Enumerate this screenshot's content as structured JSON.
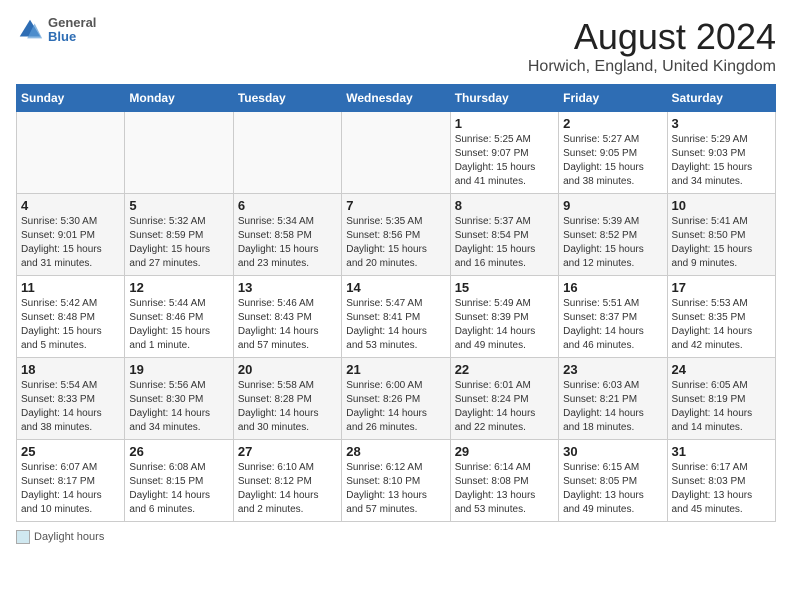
{
  "header": {
    "title": "August 2024",
    "subtitle": "Horwich, England, United Kingdom",
    "logo_general": "General",
    "logo_blue": "Blue"
  },
  "days_of_week": [
    "Sunday",
    "Monday",
    "Tuesday",
    "Wednesday",
    "Thursday",
    "Friday",
    "Saturday"
  ],
  "weeks": [
    [
      {
        "day": "",
        "info": ""
      },
      {
        "day": "",
        "info": ""
      },
      {
        "day": "",
        "info": ""
      },
      {
        "day": "",
        "info": ""
      },
      {
        "day": "1",
        "info": "Sunrise: 5:25 AM\nSunset: 9:07 PM\nDaylight: 15 hours and 41 minutes."
      },
      {
        "day": "2",
        "info": "Sunrise: 5:27 AM\nSunset: 9:05 PM\nDaylight: 15 hours and 38 minutes."
      },
      {
        "day": "3",
        "info": "Sunrise: 5:29 AM\nSunset: 9:03 PM\nDaylight: 15 hours and 34 minutes."
      }
    ],
    [
      {
        "day": "4",
        "info": "Sunrise: 5:30 AM\nSunset: 9:01 PM\nDaylight: 15 hours and 31 minutes."
      },
      {
        "day": "5",
        "info": "Sunrise: 5:32 AM\nSunset: 8:59 PM\nDaylight: 15 hours and 27 minutes."
      },
      {
        "day": "6",
        "info": "Sunrise: 5:34 AM\nSunset: 8:58 PM\nDaylight: 15 hours and 23 minutes."
      },
      {
        "day": "7",
        "info": "Sunrise: 5:35 AM\nSunset: 8:56 PM\nDaylight: 15 hours and 20 minutes."
      },
      {
        "day": "8",
        "info": "Sunrise: 5:37 AM\nSunset: 8:54 PM\nDaylight: 15 hours and 16 minutes."
      },
      {
        "day": "9",
        "info": "Sunrise: 5:39 AM\nSunset: 8:52 PM\nDaylight: 15 hours and 12 minutes."
      },
      {
        "day": "10",
        "info": "Sunrise: 5:41 AM\nSunset: 8:50 PM\nDaylight: 15 hours and 9 minutes."
      }
    ],
    [
      {
        "day": "11",
        "info": "Sunrise: 5:42 AM\nSunset: 8:48 PM\nDaylight: 15 hours and 5 minutes."
      },
      {
        "day": "12",
        "info": "Sunrise: 5:44 AM\nSunset: 8:46 PM\nDaylight: 15 hours and 1 minute."
      },
      {
        "day": "13",
        "info": "Sunrise: 5:46 AM\nSunset: 8:43 PM\nDaylight: 14 hours and 57 minutes."
      },
      {
        "day": "14",
        "info": "Sunrise: 5:47 AM\nSunset: 8:41 PM\nDaylight: 14 hours and 53 minutes."
      },
      {
        "day": "15",
        "info": "Sunrise: 5:49 AM\nSunset: 8:39 PM\nDaylight: 14 hours and 49 minutes."
      },
      {
        "day": "16",
        "info": "Sunrise: 5:51 AM\nSunset: 8:37 PM\nDaylight: 14 hours and 46 minutes."
      },
      {
        "day": "17",
        "info": "Sunrise: 5:53 AM\nSunset: 8:35 PM\nDaylight: 14 hours and 42 minutes."
      }
    ],
    [
      {
        "day": "18",
        "info": "Sunrise: 5:54 AM\nSunset: 8:33 PM\nDaylight: 14 hours and 38 minutes."
      },
      {
        "day": "19",
        "info": "Sunrise: 5:56 AM\nSunset: 8:30 PM\nDaylight: 14 hours and 34 minutes."
      },
      {
        "day": "20",
        "info": "Sunrise: 5:58 AM\nSunset: 8:28 PM\nDaylight: 14 hours and 30 minutes."
      },
      {
        "day": "21",
        "info": "Sunrise: 6:00 AM\nSunset: 8:26 PM\nDaylight: 14 hours and 26 minutes."
      },
      {
        "day": "22",
        "info": "Sunrise: 6:01 AM\nSunset: 8:24 PM\nDaylight: 14 hours and 22 minutes."
      },
      {
        "day": "23",
        "info": "Sunrise: 6:03 AM\nSunset: 8:21 PM\nDaylight: 14 hours and 18 minutes."
      },
      {
        "day": "24",
        "info": "Sunrise: 6:05 AM\nSunset: 8:19 PM\nDaylight: 14 hours and 14 minutes."
      }
    ],
    [
      {
        "day": "25",
        "info": "Sunrise: 6:07 AM\nSunset: 8:17 PM\nDaylight: 14 hours and 10 minutes."
      },
      {
        "day": "26",
        "info": "Sunrise: 6:08 AM\nSunset: 8:15 PM\nDaylight: 14 hours and 6 minutes."
      },
      {
        "day": "27",
        "info": "Sunrise: 6:10 AM\nSunset: 8:12 PM\nDaylight: 14 hours and 2 minutes."
      },
      {
        "day": "28",
        "info": "Sunrise: 6:12 AM\nSunset: 8:10 PM\nDaylight: 13 hours and 57 minutes."
      },
      {
        "day": "29",
        "info": "Sunrise: 6:14 AM\nSunset: 8:08 PM\nDaylight: 13 hours and 53 minutes."
      },
      {
        "day": "30",
        "info": "Sunrise: 6:15 AM\nSunset: 8:05 PM\nDaylight: 13 hours and 49 minutes."
      },
      {
        "day": "31",
        "info": "Sunrise: 6:17 AM\nSunset: 8:03 PM\nDaylight: 13 hours and 45 minutes."
      }
    ]
  ],
  "footer": {
    "daylight_label": "Daylight hours"
  }
}
